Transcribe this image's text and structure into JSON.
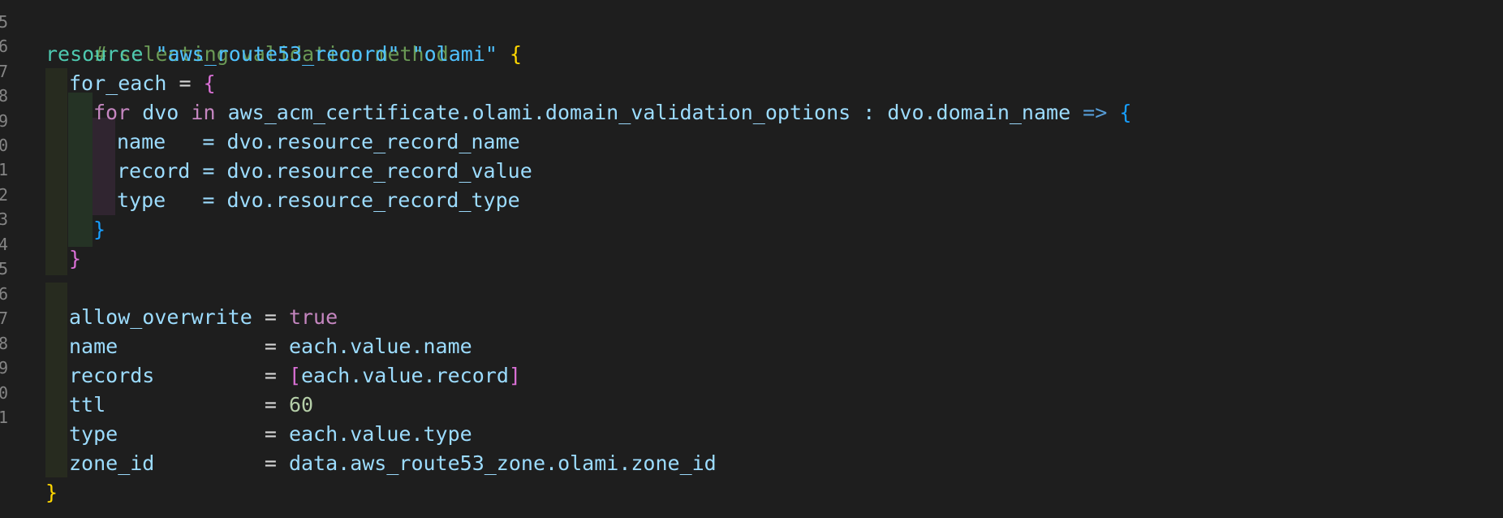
{
  "gutter": {
    "line_numbers": [
      "5",
      "6",
      "7",
      "8",
      "9",
      "0",
      "1",
      "2",
      "3",
      "4",
      "5",
      "6",
      "7",
      "8",
      "9",
      "0",
      "1"
    ]
  },
  "code": {
    "l1_comment": "# selecting validation method",
    "l2_keyword": "resource",
    "l2_type": "\"aws_route53_record\"",
    "l2_name": "\"olami\"",
    "l2_brace": "{",
    "l3_attr": "for_each",
    "l3_eq": " = ",
    "l3_brace": "{",
    "l4_for": "for",
    "l4_var": " dvo ",
    "l4_in": "in",
    "l4_expr": " aws_acm_certificate.olami.domain_validation_options : dvo.domain_name ",
    "l4_arrow": "=>",
    "l4_brace": "{",
    "l5_attr": "name",
    "l5_rest": "   = dvo.resource_record_name",
    "l6_attr": "record",
    "l6_rest": " = dvo.resource_record_value",
    "l7_attr": "type",
    "l7_rest": "   = dvo.resource_record_type",
    "l8_brace": "}",
    "l9_brace": "}",
    "l11_attr": "allow_overwrite",
    "l11_eq": " = ",
    "l11_val": "true",
    "l12_attr": "name",
    "l12_eq": "            = ",
    "l12_val": "each.value.name",
    "l13_attr": "records",
    "l13_eq": "         = ",
    "l13_open": "[",
    "l13_val": "each.value.record",
    "l13_close": "]",
    "l14_attr": "ttl",
    "l14_eq": "             = ",
    "l14_val": "60",
    "l15_attr": "type",
    "l15_eq": "            = ",
    "l15_val": "each.value.type",
    "l16_attr": "zone_id",
    "l16_eq": "         = ",
    "l16_val": "data.aws_route53_zone.olami.zone_id",
    "l17_brace": "}"
  },
  "colors": {
    "background": "#1e1e1e",
    "comment": "#6a9955",
    "keyword": "#4ec9b0",
    "string": "#4fc1ff",
    "control": "#c586c0",
    "identifier": "#9cdcfe",
    "number": "#b5cea8",
    "bracket_level1": "#ffd700",
    "bracket_level2": "#da70d6",
    "bracket_level3": "#179fff"
  }
}
